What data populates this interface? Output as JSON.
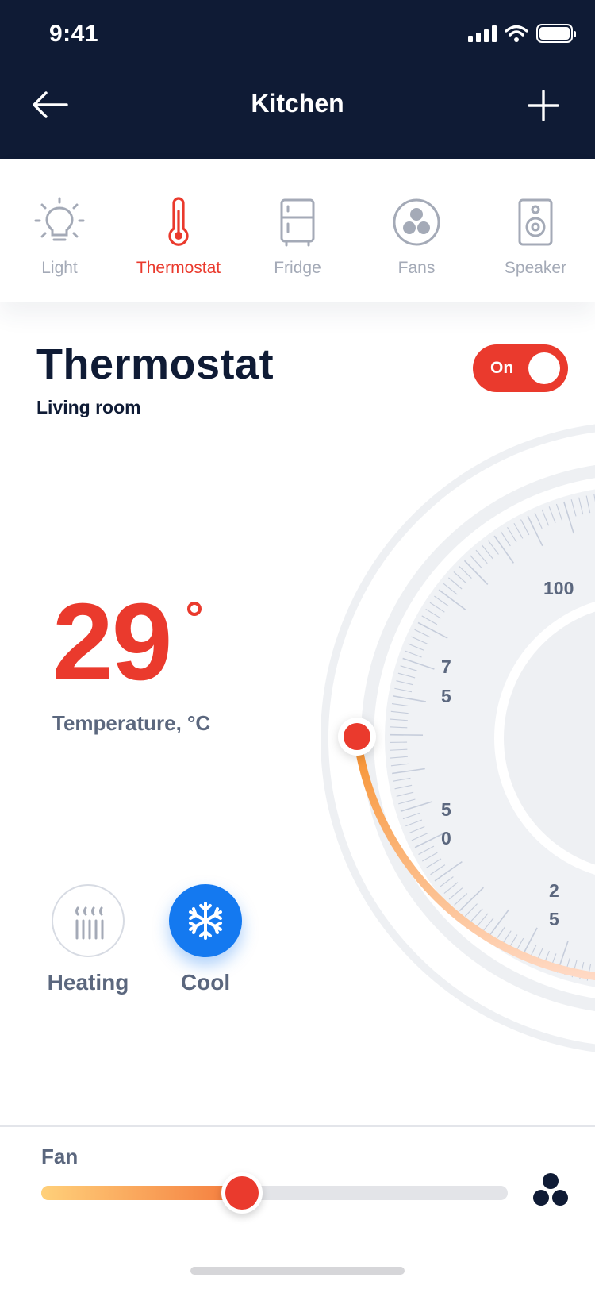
{
  "status_bar": {
    "time": "9:41"
  },
  "nav": {
    "title": "Kitchen"
  },
  "tabs": [
    {
      "label": "Light",
      "icon": "lightbulb-icon",
      "active": false
    },
    {
      "label": "Thermostat",
      "icon": "thermometer-icon",
      "active": true
    },
    {
      "label": "Fridge",
      "icon": "fridge-icon",
      "active": false
    },
    {
      "label": "Fans",
      "icon": "fan-icon",
      "active": false
    },
    {
      "label": "Speaker",
      "icon": "speaker-icon",
      "active": false
    }
  ],
  "device": {
    "title": "Thermostat",
    "room": "Living room",
    "power_label": "On",
    "power_on": true
  },
  "temperature": {
    "value": "29",
    "label": "Temperature, °C"
  },
  "dial": {
    "scale_labels": {
      "s100": "100",
      "s75a": "7",
      "s75b": "5",
      "s50a": "5",
      "s50b": "0",
      "s25a": "2",
      "s25b": "5"
    }
  },
  "modes": [
    {
      "label": "Heating",
      "icon": "radiator-icon",
      "active": false
    },
    {
      "label": "Cool",
      "icon": "snowflake-icon",
      "active": true
    }
  ],
  "fan": {
    "label": "Fan",
    "level": 0.43
  },
  "colors": {
    "header_bg": "#0f1b35",
    "accent_red": "#ea3a2d",
    "cool_blue": "#1479f0",
    "muted_text": "#5b677e",
    "inactive_icon": "#a4aab7"
  }
}
